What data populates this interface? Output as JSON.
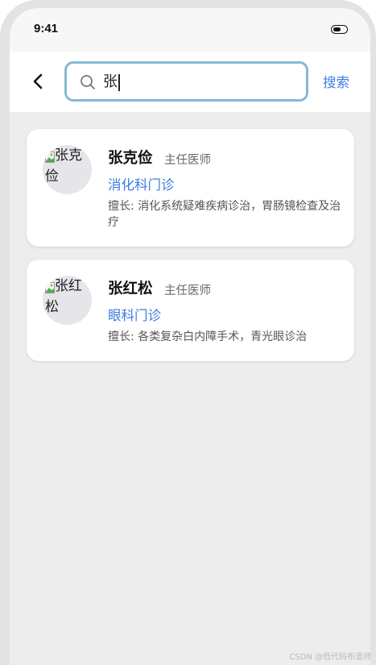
{
  "status_bar": {
    "time": "9:41"
  },
  "search": {
    "query": "张",
    "submit_label": "搜索"
  },
  "doctors": [
    {
      "avatar_alt": "张克俭",
      "name": "张克俭",
      "title": "主任医师",
      "department": "消化科门诊",
      "specialty": "擅长: 消化系统疑难疾病诊治，胃肠镜检查及治疗"
    },
    {
      "avatar_alt": "张红松",
      "name": "张红松",
      "title": "主任医师",
      "department": "眼科门诊",
      "specialty": "擅长: 各类复杂白内障手术，青光眼诊治"
    }
  ],
  "watermark": "CSDN @低代码布道师",
  "colors": {
    "accent": "#3c7ce3",
    "search_border": "#85b9d6",
    "background": "#ededed"
  }
}
